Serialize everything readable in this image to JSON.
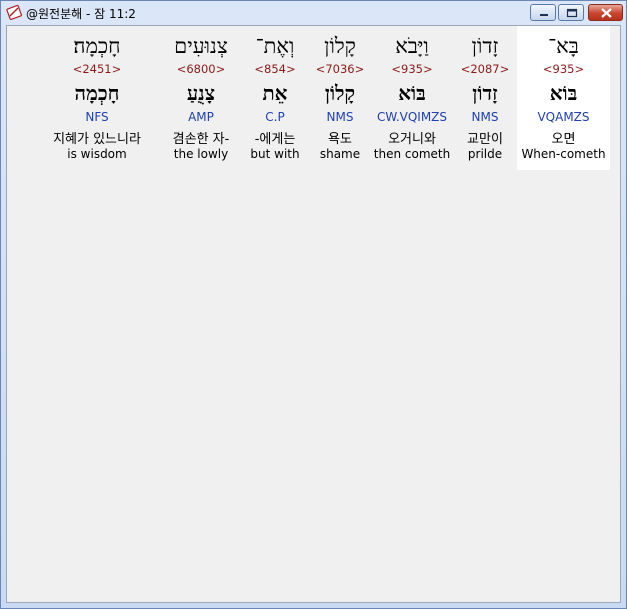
{
  "window": {
    "title": "@원전분해 - 잠 11:2",
    "controls": {
      "minimize_icon": "minimize-icon",
      "maximize_icon": "maximize-icon",
      "close_icon": "close-icon"
    }
  },
  "words": [
    {
      "hebrew": "בָּא־",
      "strongs": "<935>",
      "lemma": "בּוֹא",
      "parsing": "VQAMZS",
      "korean": "오면",
      "english": "When-cometh",
      "selected": true
    },
    {
      "hebrew": "זָדוֹן",
      "strongs": "<2087>",
      "lemma": "זָדוֹן",
      "parsing": "NMS",
      "korean": "교만이",
      "english": "prilde",
      "selected": false
    },
    {
      "hebrew": "וַיָּבֹא",
      "strongs": "<935>",
      "lemma": "בּוֹא",
      "parsing": "CW.VQIMZS",
      "korean": "오거니와",
      "english": "then cometh",
      "selected": false
    },
    {
      "hebrew": "קָלוֹן",
      "strongs": "<7036>",
      "lemma": "קָלוֹן",
      "parsing": "NMS",
      "korean": "욕도",
      "english": "shame",
      "selected": false
    },
    {
      "hebrew": "וְאֶת־",
      "strongs": "<854>",
      "lemma": "אֵת",
      "parsing": "C.P",
      "korean": "-에게는",
      "english": "but with",
      "selected": false
    },
    {
      "hebrew": "צְנוּעִים",
      "strongs": "<6800>",
      "lemma": "צָנֻעַ",
      "parsing": "AMP",
      "korean": "겸손한 자-",
      "english": "the lowly",
      "selected": false
    },
    {
      "hebrew": "חָכְמָה׃",
      "strongs": "<2451>",
      "lemma": "חָכְמָה",
      "parsing": "NFS",
      "korean": "지혜가 있느니라",
      "english": "is wisdom",
      "selected": false
    }
  ]
}
